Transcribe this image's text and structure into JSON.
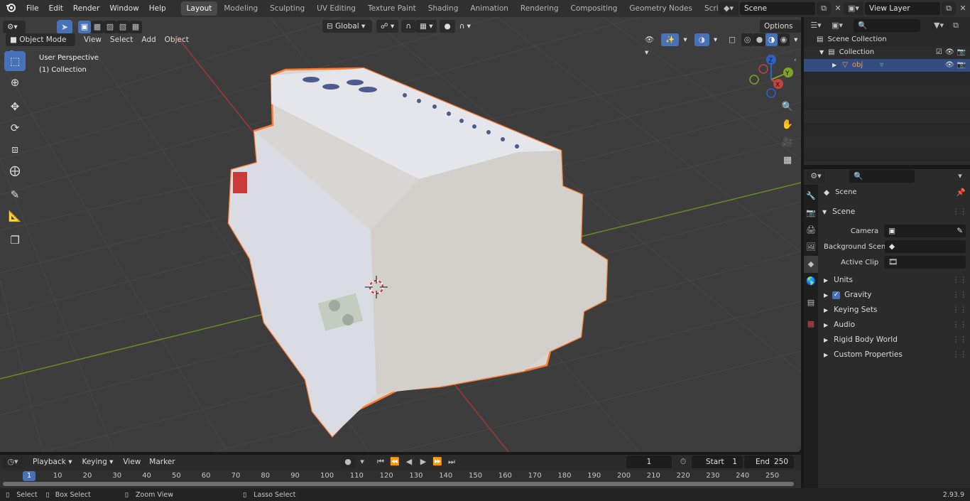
{
  "app": {
    "menus": [
      "File",
      "Edit",
      "Render",
      "Window",
      "Help"
    ],
    "workspaces": [
      "Layout",
      "Modeling",
      "Sculpting",
      "UV Editing",
      "Texture Paint",
      "Shading",
      "Animation",
      "Rendering",
      "Compositing",
      "Geometry Nodes",
      "Scripting"
    ],
    "active_workspace": "Layout",
    "add_workspace": "+",
    "scene_name": "Scene",
    "view_layer": "View Layer"
  },
  "viewport": {
    "mode": "Object Mode",
    "header_menus": [
      "View",
      "Select",
      "Add",
      "Object"
    ],
    "transform_orientation": "Global",
    "options_label": "Options",
    "overlay_title": "User Perspective",
    "overlay_collection": "(1) Collection",
    "gizmo": {
      "x": "X",
      "y": "Y",
      "z": "Z"
    },
    "tools": [
      "select-box",
      "cursor",
      "move",
      "rotate",
      "scale",
      "transform",
      "annotate",
      "measure",
      "add-cube"
    ],
    "colors": {
      "background": "#3d3d3d",
      "grid": "#4a4a4a",
      "x_axis": "#a03535",
      "y_axis": "#6b8a25",
      "selection_outline": "#ff7a2e",
      "active_tool": "#4872b8"
    }
  },
  "outliner": {
    "search_placeholder": "",
    "scene_collection": "Scene Collection",
    "collection": "Collection",
    "object": "obj"
  },
  "properties": {
    "context_title": "Scene",
    "panel_title": "Scene",
    "fields": [
      {
        "label": "Camera",
        "value": ""
      },
      {
        "label": "Background Scene",
        "value": ""
      },
      {
        "label": "Active Clip",
        "value": ""
      }
    ],
    "subpanels": [
      "Units",
      "Gravity",
      "Keying Sets",
      "Audio",
      "Rigid Body World",
      "Custom Properties"
    ],
    "gravity_checked": true
  },
  "timeline": {
    "menus": [
      "Playback",
      "Keying",
      "View",
      "Marker"
    ],
    "current_frame": "1",
    "start_label": "Start",
    "start": "1",
    "end_label": "End",
    "end": "250",
    "ruler": [
      "10",
      "20",
      "30",
      "40",
      "50",
      "60",
      "70",
      "80",
      "90",
      "100",
      "110",
      "120",
      "130",
      "140",
      "150",
      "160",
      "170",
      "180",
      "190",
      "200",
      "210",
      "220",
      "230",
      "240",
      "250"
    ],
    "playhead": "1"
  },
  "status": {
    "select": "Select",
    "box_select": "Box Select",
    "zoom_view": "Zoom View",
    "lasso_select": "Lasso Select",
    "version": "2.93.9"
  }
}
